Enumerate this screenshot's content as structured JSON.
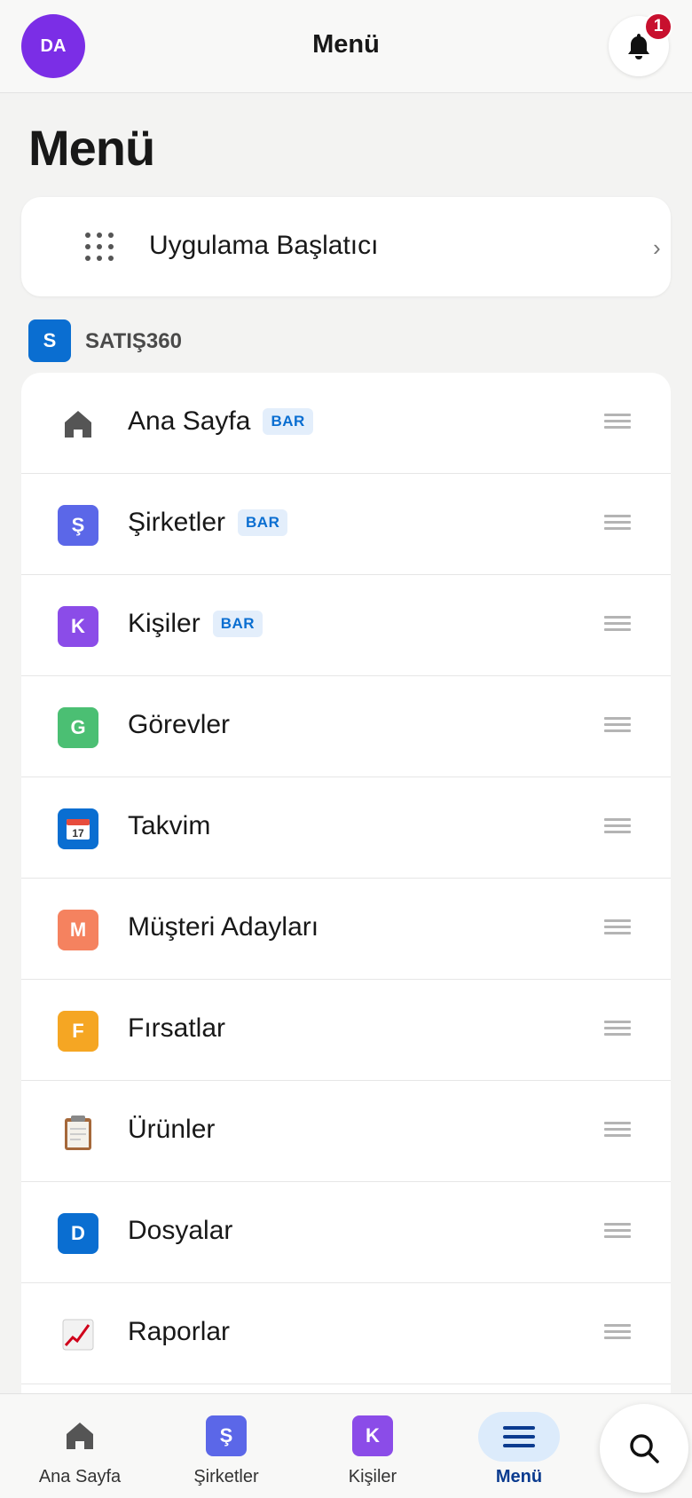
{
  "header": {
    "avatar_initials": "DA",
    "title": "Menü",
    "notification_count": "1"
  },
  "page": {
    "title": "Menü"
  },
  "launcher": {
    "label": "Uygulama Başlatıcı",
    "icon": "app-grid-icon"
  },
  "section": {
    "badge": "S",
    "title": "SATIŞ360",
    "badge_color": "#0a6ed1"
  },
  "items": [
    {
      "label": "Ana Sayfa",
      "tag": "BAR",
      "icon": "home-icon",
      "letter": "",
      "color": ""
    },
    {
      "label": "Şirketler",
      "tag": "BAR",
      "icon": "letter-icon",
      "letter": "Ş",
      "color": "#5b67e8"
    },
    {
      "label": "Kişiler",
      "tag": "BAR",
      "icon": "letter-icon",
      "letter": "K",
      "color": "#8b4ce8"
    },
    {
      "label": "Görevler",
      "tag": "",
      "icon": "letter-icon",
      "letter": "G",
      "color": "#4bbf73"
    },
    {
      "label": "Takvim",
      "tag": "",
      "icon": "calendar-icon",
      "letter": "17",
      "color": "#0a6ed1"
    },
    {
      "label": "Müşteri Adayları",
      "tag": "",
      "icon": "letter-icon",
      "letter": "M",
      "color": "#f5825f"
    },
    {
      "label": "Fırsatlar",
      "tag": "",
      "icon": "letter-icon",
      "letter": "F",
      "color": "#f5a623"
    },
    {
      "label": "Ürünler",
      "tag": "",
      "icon": "clipboard-icon",
      "letter": "",
      "color": ""
    },
    {
      "label": "Dosyalar",
      "tag": "",
      "icon": "letter-icon",
      "letter": "D",
      "color": "#0a6ed1"
    },
    {
      "label": "Raporlar",
      "tag": "",
      "icon": "chart-icon",
      "letter": "",
      "color": ""
    }
  ],
  "bottom_nav": {
    "home_label": "Ana Sayfa",
    "companies_label": "Şirketler",
    "companies_letter": "Ş",
    "contacts_label": "Kişiler",
    "contacts_letter": "K",
    "menu_label": "Menü"
  },
  "colors": {
    "accent": "#0a6ed1",
    "avatar": "#7b2ee6",
    "badge": "#c8102e"
  }
}
